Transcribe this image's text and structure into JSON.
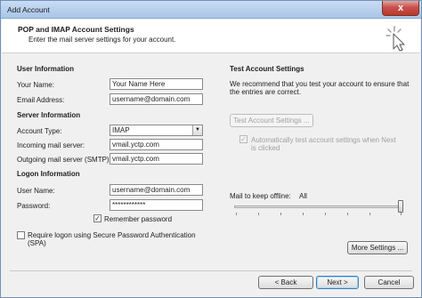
{
  "window": {
    "title": "Add Account",
    "close_symbol": "x"
  },
  "header": {
    "title": "POP and IMAP Account Settings",
    "subtitle": "Enter the mail server settings for your account."
  },
  "user_info": {
    "heading": "User Information",
    "name_label": "Your Name:",
    "name_value": "Your Name Here",
    "email_label": "Email Address:",
    "email_value": "username@domain.com"
  },
  "server_info": {
    "heading": "Server Information",
    "account_type_label": "Account Type:",
    "account_type_value": "IMAP",
    "incoming_label": "Incoming mail server:",
    "incoming_value": "vmail.yctp.com",
    "outgoing_label": "Outgoing mail server (SMTP):",
    "outgoing_value": "vmail.yctp.com"
  },
  "logon_info": {
    "heading": "Logon Information",
    "username_label": "User Name:",
    "username_value": "username@domain.com",
    "password_label": "Password:",
    "password_value": "************",
    "remember_label": "Remember password",
    "remember_checked": true,
    "spa_label_line1": "Require logon using Secure Password Authentication",
    "spa_label_line2": "(SPA)",
    "spa_checked": false
  },
  "test_settings": {
    "heading": "Test Account Settings",
    "description_line1": "We recommend that you test your account to ensure that",
    "description_line2": "the entries are correct.",
    "test_button": "Test Account Settings ...",
    "auto_test_line1": "Automatically test account settings when Next",
    "auto_test_line2": "is clicked",
    "auto_test_checked": true
  },
  "offline": {
    "label": "Mail to keep offline:",
    "value": "All",
    "slider_level": 1.0
  },
  "buttons": {
    "more_settings": "More Settings ...",
    "back": "< Back",
    "next": "Next >",
    "cancel": "Cancel"
  }
}
